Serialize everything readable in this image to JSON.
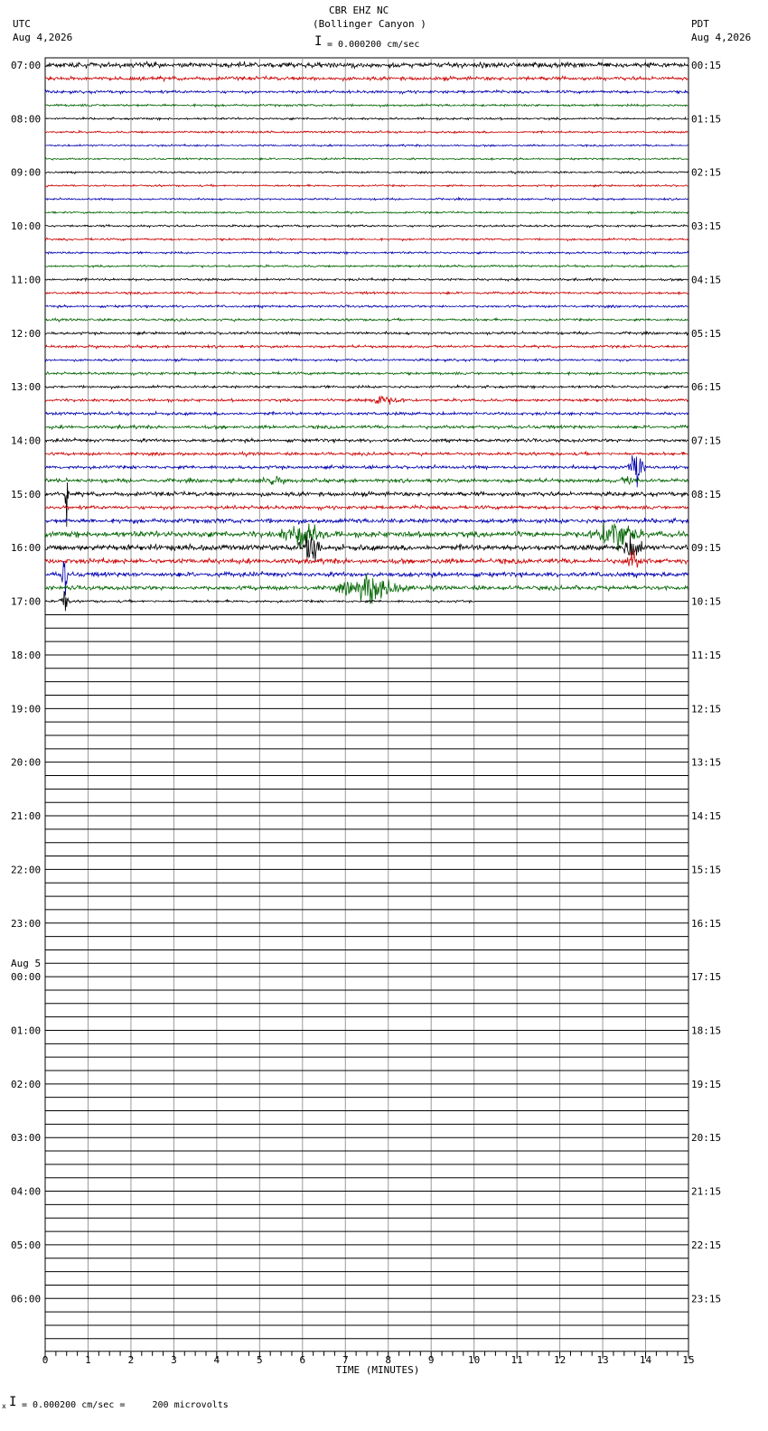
{
  "header": {
    "title": "CBR EHZ NC",
    "subtitle": "(Bollinger Canyon )",
    "left_zone": "UTC",
    "left_date": "Aug 4,2026",
    "right_zone": "PDT",
    "right_date": "Aug 4,2026",
    "scale_text": "= 0.000200 cm/sec"
  },
  "footer": {
    "scale_text": "= 0.000200 cm/sec =     200 microvolts",
    "prefix": "x"
  },
  "colors": {
    "grid": "#9a9a9a",
    "trace_colors": [
      "#000000",
      "#cc0000",
      "#0000b0",
      "#006400"
    ]
  },
  "chart_data": {
    "type": "line",
    "description_kind": "helicorder",
    "xlabel": "TIME (MINUTES)",
    "xlim": [
      0,
      15
    ],
    "x_ticks": [
      "0",
      "1",
      "2",
      "3",
      "4",
      "5",
      "6",
      "7",
      "8",
      "9",
      "10",
      "11",
      "12",
      "13",
      "14",
      "15"
    ],
    "rows_total": 96,
    "rows_per_hour": 4,
    "minutes_per_row": 15,
    "recorded_full_rows": 40,
    "last_row_end_minute": 10,
    "utc_labels": [
      "07:00",
      "08:00",
      "09:00",
      "10:00",
      "11:00",
      "12:00",
      "13:00",
      "14:00",
      "15:00",
      "16:00",
      "17:00",
      "18:00",
      "19:00",
      "20:00",
      "21:00",
      "22:00",
      "23:00",
      "00:00",
      "01:00",
      "02:00",
      "03:00",
      "04:00",
      "05:00",
      "06:00"
    ],
    "utc_date_change": {
      "hour_index": 17,
      "text": "Aug 5"
    },
    "pdt_labels": [
      "00:15",
      "01:15",
      "02:15",
      "03:15",
      "04:15",
      "05:15",
      "06:15",
      "07:15",
      "08:15",
      "09:15",
      "10:15",
      "11:15",
      "12:15",
      "13:15",
      "14:15",
      "15:15",
      "16:15",
      "17:15",
      "18:15",
      "19:15",
      "20:15",
      "21:15",
      "22:15",
      "23:15"
    ],
    "noise_by_row": [
      2.2,
      1.6,
      1.2,
      1.0,
      0.9,
      0.9,
      0.8,
      0.8,
      0.8,
      0.8,
      0.8,
      0.8,
      0.9,
      0.9,
      0.9,
      0.9,
      1.0,
      1.0,
      1.0,
      1.0,
      1.1,
      1.1,
      1.0,
      1.1,
      1.1,
      1.2,
      1.3,
      1.4,
      1.4,
      1.3,
      1.4,
      1.6,
      1.8,
      1.5,
      2.0,
      2.5,
      2.4,
      2.2,
      2.0,
      1.8,
      1.0
    ],
    "events": [
      {
        "row": 25,
        "minute": 7.8,
        "duration": 0.9,
        "amplitude": 4
      },
      {
        "row": 30,
        "minute": 13.8,
        "duration": 0.3,
        "amplitude": 22
      },
      {
        "row": 31,
        "minute": 5.3,
        "duration": 0.5,
        "amplitude": 3
      },
      {
        "row": 31,
        "minute": 13.6,
        "duration": 0.3,
        "amplitude": 4
      },
      {
        "row": 32,
        "minute": 0.5,
        "duration": 0.05,
        "amplitude": 80
      },
      {
        "row": 35,
        "minute": 6.0,
        "duration": 0.9,
        "amplitude": 12
      },
      {
        "row": 35,
        "minute": 13.3,
        "duration": 0.8,
        "amplitude": 18
      },
      {
        "row": 36,
        "minute": 6.2,
        "duration": 0.4,
        "amplitude": 16
      },
      {
        "row": 36,
        "minute": 13.7,
        "duration": 0.4,
        "amplitude": 14
      },
      {
        "row": 37,
        "minute": 13.7,
        "duration": 0.3,
        "amplitude": 10
      },
      {
        "row": 38,
        "minute": 0.45,
        "duration": 0.12,
        "amplitude": 30
      },
      {
        "row": 39,
        "minute": 7.6,
        "duration": 1.2,
        "amplitude": 14
      },
      {
        "row": 40,
        "minute": 0.45,
        "duration": 0.15,
        "amplitude": 20
      }
    ]
  }
}
